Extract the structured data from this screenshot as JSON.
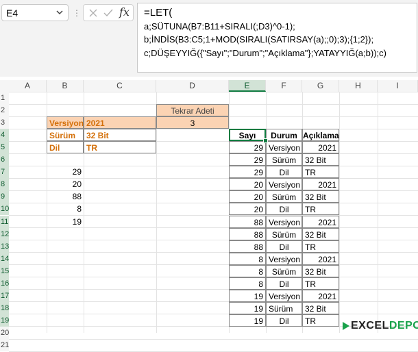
{
  "namebox": {
    "value": "E4"
  },
  "formula_bar": {
    "lines": [
      "=LET(",
      "a;SÜTUNA(B7:B11+SIRALI(;D3)^0-1);",
      "b;İNDİS(B3:C5;1+MOD(SIRALI(SATIRSAY(a);;0);3);{1;2});",
      "c;DÜŞEYYIĞ({\"Sayı\";\"Durum\";\"Açıklama\"};YATAYYIĞ(a;b));c)"
    ],
    "fx_label": "fx"
  },
  "columns": [
    "A",
    "B",
    "C",
    "D",
    "E",
    "F",
    "G",
    "H",
    "I"
  ],
  "rows": [
    "1",
    "2",
    "3",
    "4",
    "5",
    "6",
    "7",
    "8",
    "9",
    "10",
    "11",
    "12",
    "13",
    "14",
    "15",
    "16",
    "17",
    "18",
    "19",
    "20",
    "21"
  ],
  "params": {
    "labels": [
      "Versiyon",
      "Sürüm",
      "Dil"
    ],
    "values": [
      "2021",
      "32 Bit",
      "TR"
    ]
  },
  "tekrar": {
    "label": "Tekrar Adeti",
    "value": "3"
  },
  "numbers": [
    "29",
    "20",
    "88",
    "8",
    "19"
  ],
  "result": {
    "headers": [
      "Sayı",
      "Durum",
      "Açıklama"
    ],
    "rows": [
      [
        "29",
        "Versiyon",
        "2021"
      ],
      [
        "29",
        "Sürüm",
        "32 Bit"
      ],
      [
        "29",
        "Dil",
        "TR"
      ],
      [
        "20",
        "Versiyon",
        "2021"
      ],
      [
        "20",
        "Sürüm",
        "32 Bit"
      ],
      [
        "20",
        "Dil",
        "TR"
      ],
      [
        "88",
        "Versiyon",
        "2021"
      ],
      [
        "88",
        "Sürüm",
        "32 Bit"
      ],
      [
        "88",
        "Dil",
        "TR"
      ],
      [
        "8",
        "Versiyon",
        "2021"
      ],
      [
        "8",
        "Sürüm",
        "32 Bit"
      ],
      [
        "8",
        "Dil",
        "TR"
      ],
      [
        "19",
        "Versiyon",
        "2021"
      ],
      [
        "19",
        "Sürüm",
        "32 Bit"
      ],
      [
        "19",
        "Dil",
        "TR"
      ]
    ]
  },
  "logo": {
    "part1": "EXCEL",
    "part2": "DEPO"
  },
  "colors": {
    "accent": "#107c41",
    "orange_fill": "#fbd3b3",
    "orange_text": "#d4700a"
  }
}
